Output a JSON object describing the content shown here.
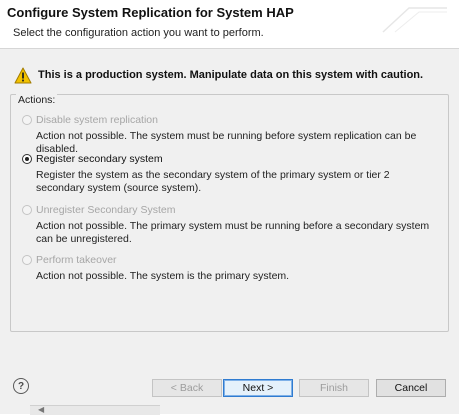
{
  "header": {
    "title": "Configure System Replication for System HAP",
    "subtitle": "Select the configuration action you want to perform."
  },
  "warning": {
    "text": "This is a production system. Manipulate data on this system with caution.",
    "icon": "warning-icon",
    "color": "#f2c200"
  },
  "actions": {
    "label": "Actions:",
    "options": [
      {
        "label": "Disable system replication",
        "description": "Action not possible. The system must be running before system replication can be disabled.",
        "selected": false,
        "enabled": false
      },
      {
        "label": "Register secondary system",
        "description": "Register the system as the secondary system of the primary system or tier 2 secondary system (source system).",
        "selected": true,
        "enabled": true
      },
      {
        "label": "Unregister Secondary System",
        "description": "Action not possible. The primary system must be running before a secondary system can be unregistered.",
        "selected": false,
        "enabled": false
      },
      {
        "label": "Perform takeover",
        "description": "Action not possible. The system is the primary system.",
        "selected": false,
        "enabled": false
      }
    ]
  },
  "footer": {
    "help_icon": "help-icon",
    "help_glyph": "?",
    "back_label": "< Back",
    "next_label": "Next >",
    "finish_label": "Finish",
    "cancel_label": "Cancel"
  }
}
